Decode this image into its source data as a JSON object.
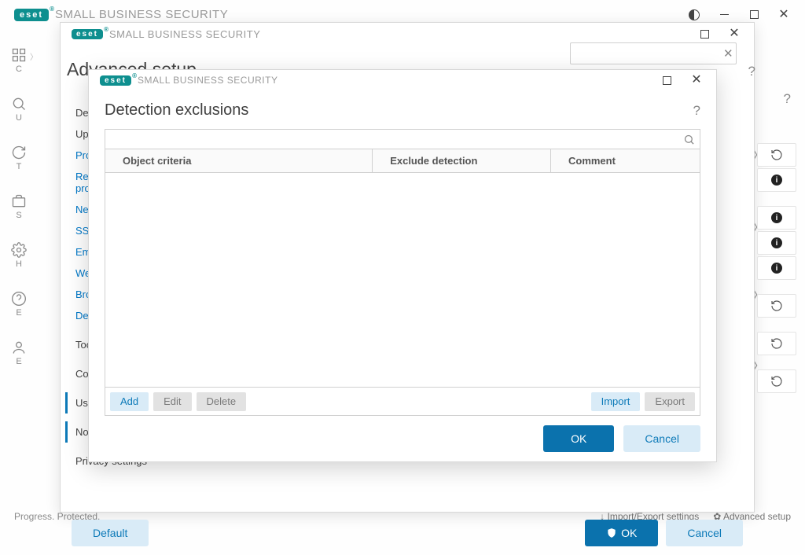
{
  "app": {
    "brand": "eset",
    "product": "SMALL BUSINESS SECURITY"
  },
  "main": {
    "sidebar_extra": [
      "C",
      "U",
      "T",
      "S",
      "H",
      "E"
    ],
    "statusbar_left": "Progress. Protected.",
    "statusbar_right1": "Import/Export settings",
    "statusbar_right2": "Advanced setup"
  },
  "adv": {
    "title": "Advanced setup",
    "search_placeholder": "",
    "nav": {
      "detection": "Detection engine",
      "update": "Update",
      "protections": "Protections",
      "realtime": "Real-time file system protection",
      "network": "Network protection",
      "ssltls": "SSL/TLS",
      "email": "Email protection",
      "web": "Web access protection",
      "browser": "Browser protection",
      "device": "Device control",
      "tools": "Tools",
      "connectivity": "Connectivity",
      "userif": "User interface",
      "notifications": "Notifications",
      "privacy": "Privacy settings"
    },
    "footer": {
      "default": "Default",
      "ok": "OK",
      "cancel": "Cancel"
    }
  },
  "excl": {
    "title": "Detection exclusions",
    "columns": {
      "object": "Object criteria",
      "detection": "Exclude detection",
      "comment": "Comment"
    },
    "rows": [],
    "actions": {
      "add": "Add",
      "edit": "Edit",
      "delete": "Delete",
      "import": "Import",
      "export": "Export"
    },
    "footer": {
      "ok": "OK",
      "cancel": "Cancel"
    }
  }
}
